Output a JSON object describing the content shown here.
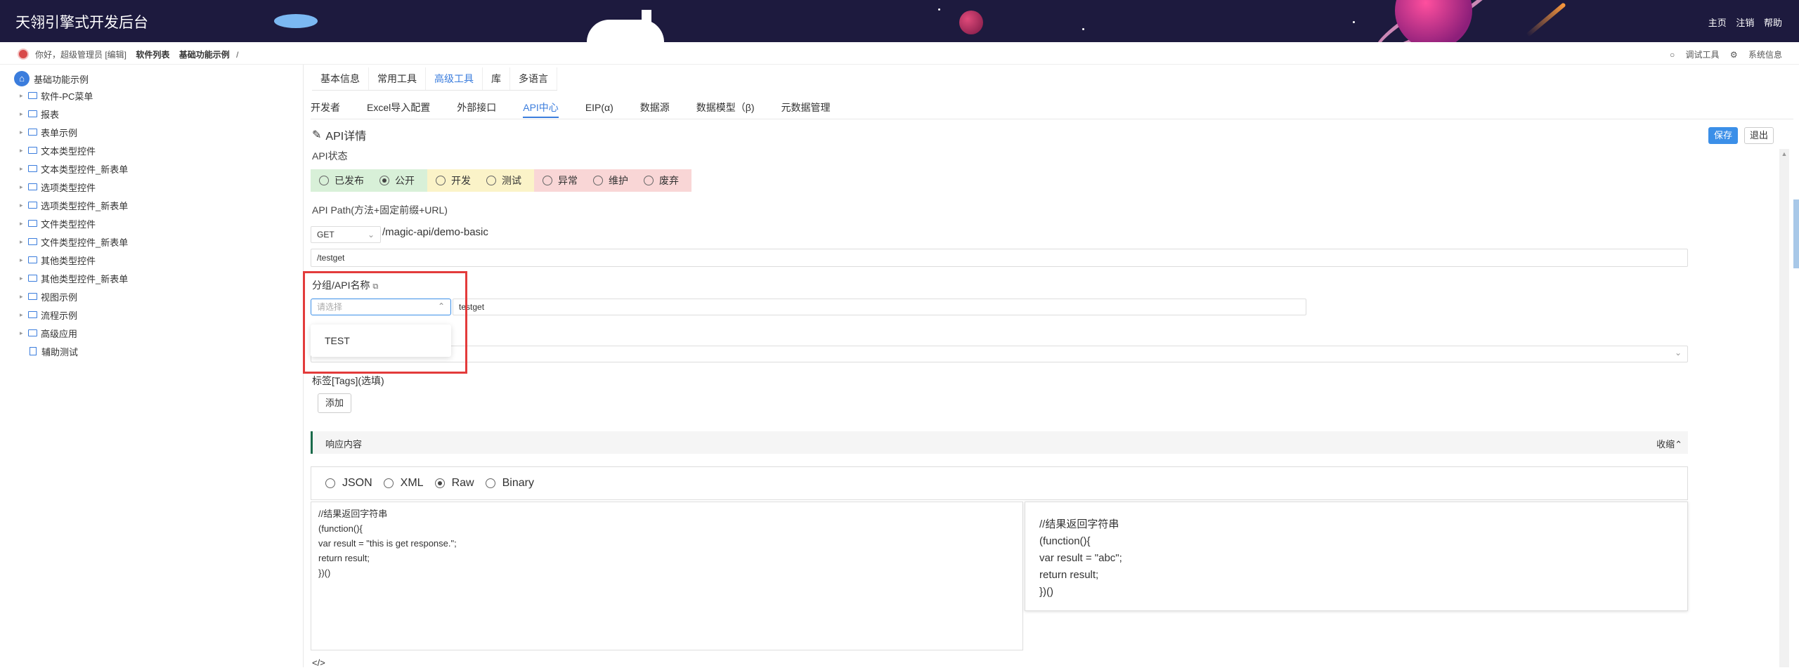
{
  "header": {
    "app_title": "天翎引擎式开发后台",
    "nav": [
      "主页",
      "注销",
      "帮助"
    ]
  },
  "breadcrumb": {
    "greeting": "你好，超级管理员 [编辑]",
    "items": [
      "软件列表",
      "基础功能示例",
      "/"
    ],
    "tools": [
      "调试工具",
      "系统信息"
    ]
  },
  "sidebar": {
    "root": "基础功能示例",
    "items": [
      {
        "label": "软件-PC菜单",
        "type": "folder"
      },
      {
        "label": "报表",
        "type": "folder"
      },
      {
        "label": "表单示例",
        "type": "folder"
      },
      {
        "label": "文本类型控件",
        "type": "folder"
      },
      {
        "label": "文本类型控件_新表单",
        "type": "folder"
      },
      {
        "label": "选项类型控件",
        "type": "folder"
      },
      {
        "label": "选项类型控件_新表单",
        "type": "folder"
      },
      {
        "label": "文件类型控件",
        "type": "folder"
      },
      {
        "label": "文件类型控件_新表单",
        "type": "folder"
      },
      {
        "label": "其他类型控件",
        "type": "folder"
      },
      {
        "label": "其他类型控件_新表单",
        "type": "folder"
      },
      {
        "label": "视图示例",
        "type": "folder"
      },
      {
        "label": "流程示例",
        "type": "folder"
      },
      {
        "label": "高级应用",
        "type": "folder"
      },
      {
        "label": "辅助测试",
        "type": "doc"
      }
    ]
  },
  "tabs_primary": [
    "基本信息",
    "常用工具",
    "高级工具",
    "库",
    "多语言"
  ],
  "tabs_primary_active": 2,
  "tabs_secondary": [
    "开发者",
    "Excel导入配置",
    "外部接口",
    "API中心",
    "EIP(α)",
    "数据源",
    "数据模型（β)",
    "元数据管理"
  ],
  "tabs_secondary_active": 3,
  "detail": {
    "title": "API详情",
    "save": "保存",
    "exit": "退出",
    "status_label": "API状态",
    "status_options": [
      {
        "label": "已发布",
        "group": "green",
        "checked": false
      },
      {
        "label": "公开",
        "group": "green",
        "checked": true
      },
      {
        "label": "开发",
        "group": "yellow",
        "checked": false
      },
      {
        "label": "测试",
        "group": "yellow",
        "checked": false
      },
      {
        "label": "异常",
        "group": "red",
        "checked": false
      },
      {
        "label": "维护",
        "group": "red",
        "checked": false
      },
      {
        "label": "废弃",
        "group": "red",
        "checked": false
      }
    ],
    "path_label": "API Path(方法+固定前缀+URL)",
    "method": "GET",
    "prefix": "/magic-api/demo-basic",
    "path_value": "/testget",
    "group_label": "分组/API名称",
    "group_placeholder": "请选择",
    "name_value": "testget",
    "dropdown_option": "TEST",
    "tags_label": "标签[Tags](选填)",
    "add_button": "添加",
    "response_title": "响应内容",
    "collapse": "收缩",
    "formats": [
      {
        "label": "JSON",
        "checked": false
      },
      {
        "label": "XML",
        "checked": false
      },
      {
        "label": "Raw",
        "checked": true
      },
      {
        "label": "Binary",
        "checked": false
      }
    ],
    "code_left": "//结果返回字符串\n(function(){\nvar result = \"this is get response.\";\nreturn result;\n})()",
    "code_right": "//结果返回字符串\n(function(){\nvar result = \"abc\";\nreturn result;\n})()",
    "code_end": "</>"
  }
}
